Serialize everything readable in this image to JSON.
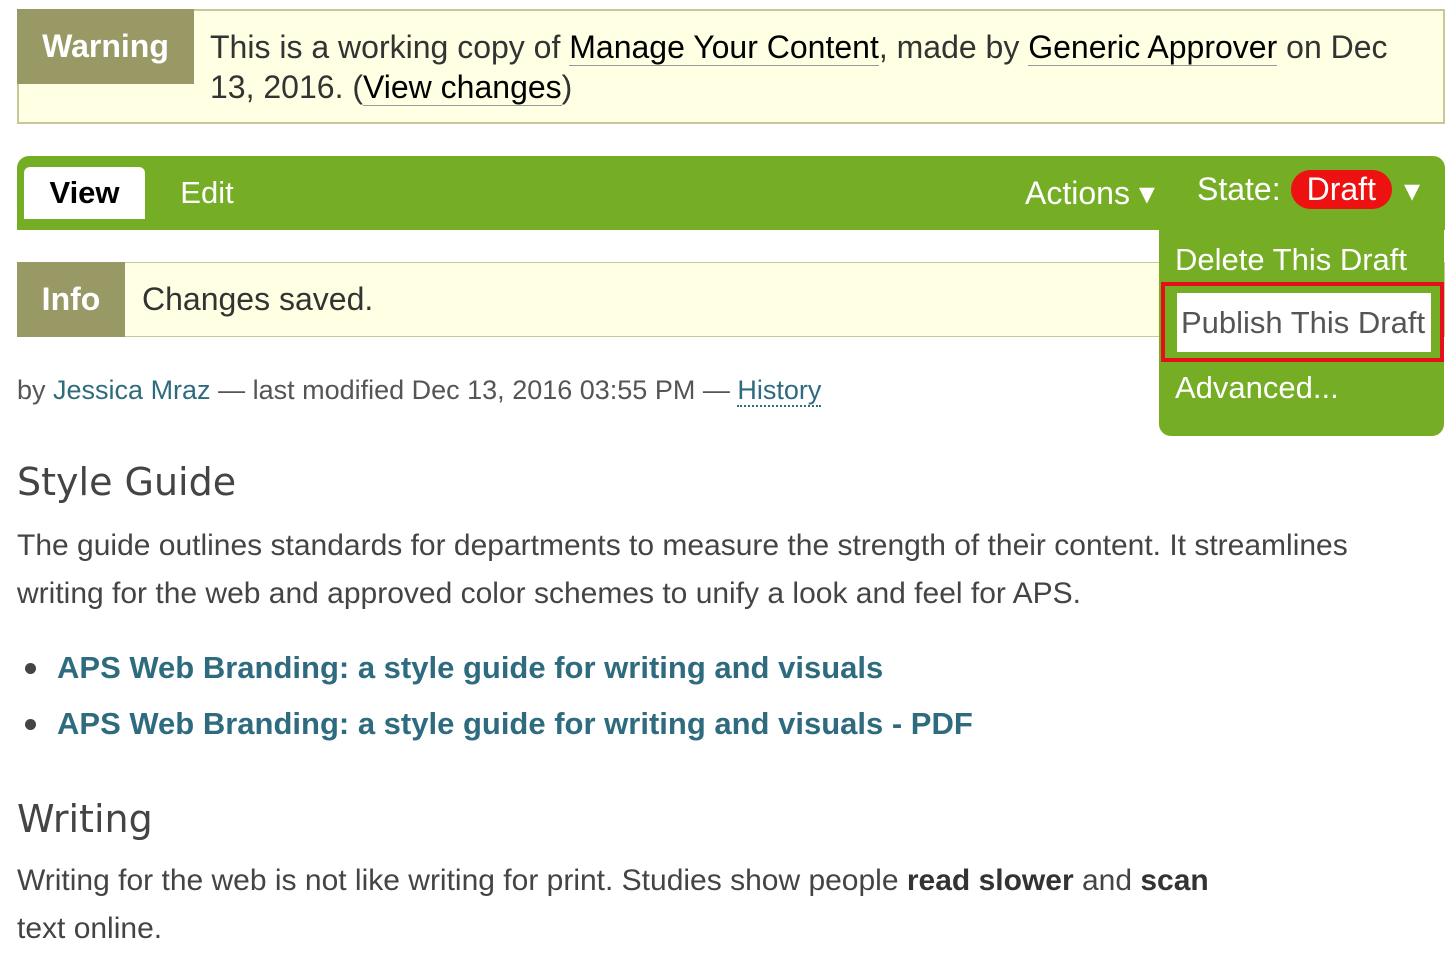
{
  "warning": {
    "label": "Warning",
    "text_prefix": "This is a working copy of ",
    "content_link": "Manage Your Content",
    "text_middle": ", made by ",
    "author_link": "Generic Approver",
    "text_suffix": " on Dec 13, 2016. (",
    "changes_link": "View changes",
    "text_end": ")"
  },
  "toolbar": {
    "tab_view": "View",
    "tab_edit": "Edit",
    "actions_label": "Actions ▾",
    "state_label": "State:",
    "state_value": "Draft",
    "state_caret": "▾"
  },
  "state_menu": {
    "delete": "Delete This Draft",
    "publish": "Publish This Draft",
    "advanced": "Advanced..."
  },
  "info": {
    "label": "Info",
    "message": "Changes saved."
  },
  "byline": {
    "by": "by ",
    "author": "Jessica Mraz",
    "modified": " — last modified Dec 13, 2016 03:55 PM — ",
    "history": "History"
  },
  "content": {
    "heading1": "Style Guide",
    "paragraph1": "The guide outlines standards for departments to measure the strength of their content. It streamlines writing for the web and approved color schemes to unify a look and feel for APS.",
    "links": [
      "APS Web Branding: a style guide for writing and visuals",
      "APS Web Branding: a style guide for writing and visuals - PDF"
    ],
    "heading2": "Writing",
    "paragraph2_start": "Writing for the web is not like writing for print. Studies show people ",
    "paragraph2_bold1": "read slower",
    "paragraph2_mid": " and ",
    "paragraph2_bold2": "scan",
    "paragraph2_end": " text online."
  },
  "colors": {
    "toolbar_green": "#75ad24",
    "banner_bg": "#ffffe3",
    "label_olive": "#999966",
    "draft_red": "#ee1111",
    "highlight_red": "#e3101b",
    "link_teal": "#2f6b7f"
  }
}
